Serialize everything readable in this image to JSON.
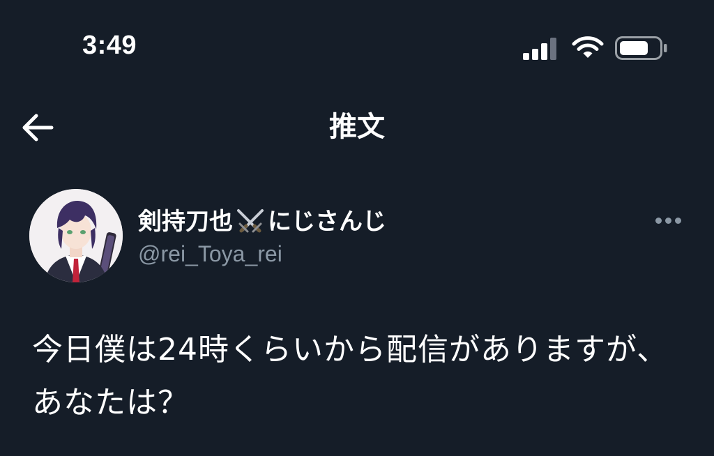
{
  "status_bar": {
    "time": "3:49",
    "signal_icon": "cellular-signal-icon",
    "wifi_icon": "wifi-icon",
    "battery_icon": "battery-icon",
    "signal_bars_filled": 3,
    "signal_bars_total": 4
  },
  "nav": {
    "back_icon": "back-arrow-icon",
    "title": "推文"
  },
  "tweet": {
    "author": {
      "name_part1": "剣持刀也",
      "name_emoji": "crossed-swords-icon",
      "name_part2": "にじさんじ",
      "handle": "@rei_Toya_rei",
      "avatar": "avatar"
    },
    "more_icon": "more-options-icon",
    "text": "今日僕は24時くらいから配信がありますが、あなたは？"
  },
  "colors": {
    "background": "#151d28",
    "text": "#ffffff",
    "secondary_text": "#8b98a5"
  }
}
